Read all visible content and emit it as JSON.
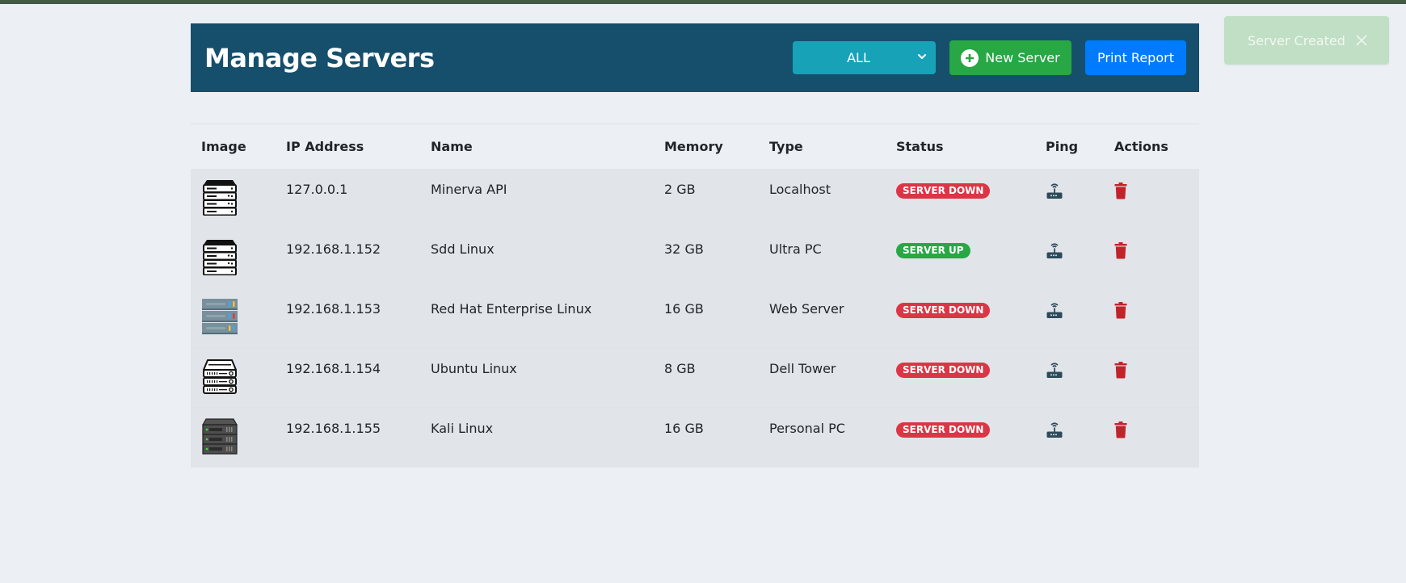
{
  "header": {
    "title": "Manage Servers",
    "filter": {
      "selected": "ALL"
    },
    "new_server_label": "New Server",
    "print_report_label": "Print Report"
  },
  "toast": {
    "message": "Server Created",
    "close_icon": "close-icon"
  },
  "table": {
    "columns": [
      "Image",
      "IP Address",
      "Name",
      "Memory",
      "Type",
      "Status",
      "Ping",
      "Actions"
    ],
    "rows": [
      {
        "image": "server-rack-black-icon",
        "ip": "127.0.0.1",
        "name": "Minerva API",
        "memory": "2 GB",
        "type": "Localhost",
        "status": "SERVER DOWN",
        "status_kind": "down"
      },
      {
        "image": "server-rack-black-icon",
        "ip": "192.168.1.152",
        "name": "Sdd Linux",
        "memory": "32 GB",
        "type": "Ultra PC",
        "status": "SERVER UP",
        "status_kind": "up"
      },
      {
        "image": "server-rack-colored-icon",
        "ip": "192.168.1.153",
        "name": "Red Hat Enterprise Linux",
        "memory": "16 GB",
        "type": "Web Server",
        "status": "SERVER DOWN",
        "status_kind": "down"
      },
      {
        "image": "server-rack-outline-icon",
        "ip": "192.168.1.154",
        "name": "Ubuntu Linux",
        "memory": "8 GB",
        "type": "Dell Tower",
        "status": "SERVER DOWN",
        "status_kind": "down"
      },
      {
        "image": "server-rack-gray-icon",
        "ip": "192.168.1.155",
        "name": "Kali Linux",
        "memory": "16 GB",
        "type": "Personal PC",
        "status": "SERVER DOWN",
        "status_kind": "down"
      }
    ]
  },
  "colors": {
    "header_bg": "#164f6c",
    "select_bg": "#17a2b8",
    "new_button_bg": "#28a745",
    "print_button_bg": "#007bff",
    "status_down": "#dc3545",
    "status_up": "#28a745",
    "trash": "#c0242a",
    "ping": "#2c4a5a",
    "toast_bg": "#c0dfc4"
  }
}
